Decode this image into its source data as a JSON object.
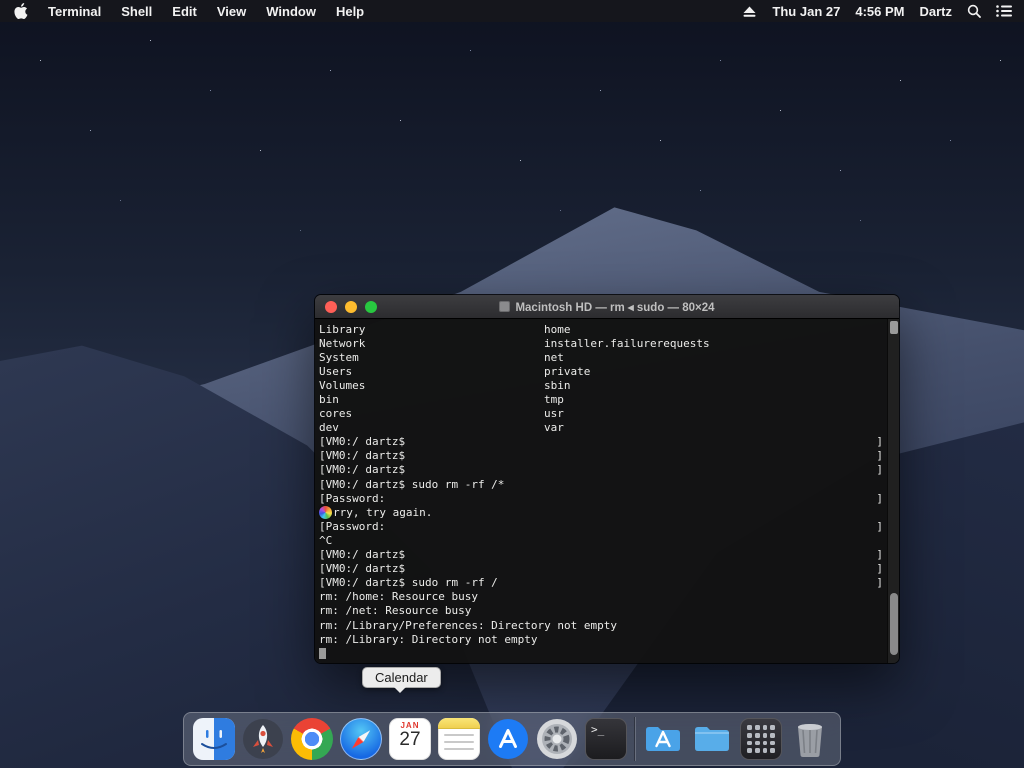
{
  "menu_bar": {
    "app_name": "Terminal",
    "items": [
      "Shell",
      "Edit",
      "View",
      "Window",
      "Help"
    ],
    "date": "Thu Jan 27",
    "time": "4:56 PM",
    "user": "Dartz"
  },
  "window": {
    "title": "Macintosh HD — rm ◂ sudo — 80×24"
  },
  "terminal": {
    "lines": [
      {
        "c1": "Library",
        "c2": "home"
      },
      {
        "c1": "Network",
        "c2": "installer.failurerequests"
      },
      {
        "c1": "System",
        "c2": "net"
      },
      {
        "c1": "Users",
        "c2": "private"
      },
      {
        "c1": "Volumes",
        "c2": "sbin"
      },
      {
        "c1": "bin",
        "c2": "tmp"
      },
      {
        "c1": "cores",
        "c2": "usr"
      },
      {
        "c1": "dev",
        "c2": "var"
      },
      {
        "t": "[VM0:/ dartz$",
        "r": "]"
      },
      {
        "t": "[VM0:/ dartz$",
        "r": "]"
      },
      {
        "t": "[VM0:/ dartz$",
        "r": "]"
      },
      {
        "t": "[VM0:/ dartz$ sudo rm -rf /*"
      },
      {
        "t": "[Password:",
        "r": "]"
      },
      {
        "t": "rry, try again.",
        "icon": true
      },
      {
        "t": "[Password:",
        "r": "]"
      },
      {
        "t": "^C"
      },
      {
        "t": "[VM0:/ dartz$",
        "r": "]"
      },
      {
        "t": "[VM0:/ dartz$",
        "r": "]"
      },
      {
        "t": "[VM0:/ dartz$ sudo rm -rf /",
        "r": "]"
      },
      {
        "t": "rm: /home: Resource busy"
      },
      {
        "t": "rm: /net: Resource busy"
      },
      {
        "t": "rm: /Library/Preferences: Directory not empty"
      },
      {
        "t": "rm: /Library: Directory not empty"
      },
      {
        "t": "",
        "cursor": true
      }
    ]
  },
  "tooltip": {
    "label": "Calendar"
  },
  "dock": {
    "calendar": {
      "month": "JAN",
      "day": "27"
    },
    "terminal_glyph": ">_",
    "items": [
      "finder",
      "launchpad",
      "chrome",
      "safari",
      "calendar",
      "notes",
      "app-store",
      "system-preferences",
      "terminal",
      "separator",
      "applications-folder",
      "documents-folder",
      "apps-stack",
      "trash"
    ]
  },
  "colors": {
    "red": "#ff5f57",
    "yellow": "#febc2e",
    "green": "#28c840"
  }
}
